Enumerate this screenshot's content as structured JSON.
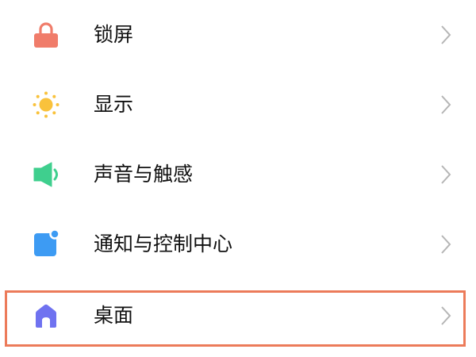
{
  "settings": {
    "items": [
      {
        "label": "锁屏",
        "icon": "lock-icon",
        "color": "#f07c6a"
      },
      {
        "label": "显示",
        "icon": "sun-icon",
        "color": "#f9c23c"
      },
      {
        "label": "声音与触感",
        "icon": "speaker-icon",
        "color": "#3fcf8e"
      },
      {
        "label": "通知与控制中心",
        "icon": "notification-icon",
        "color": "#3d9bf3"
      },
      {
        "label": "桌面",
        "icon": "home-icon",
        "color": "#6f72f0"
      }
    ],
    "highlighted_item": "桌面",
    "highlight_color": "#ec7b5a",
    "chevron_color": "#b5b5b5"
  }
}
